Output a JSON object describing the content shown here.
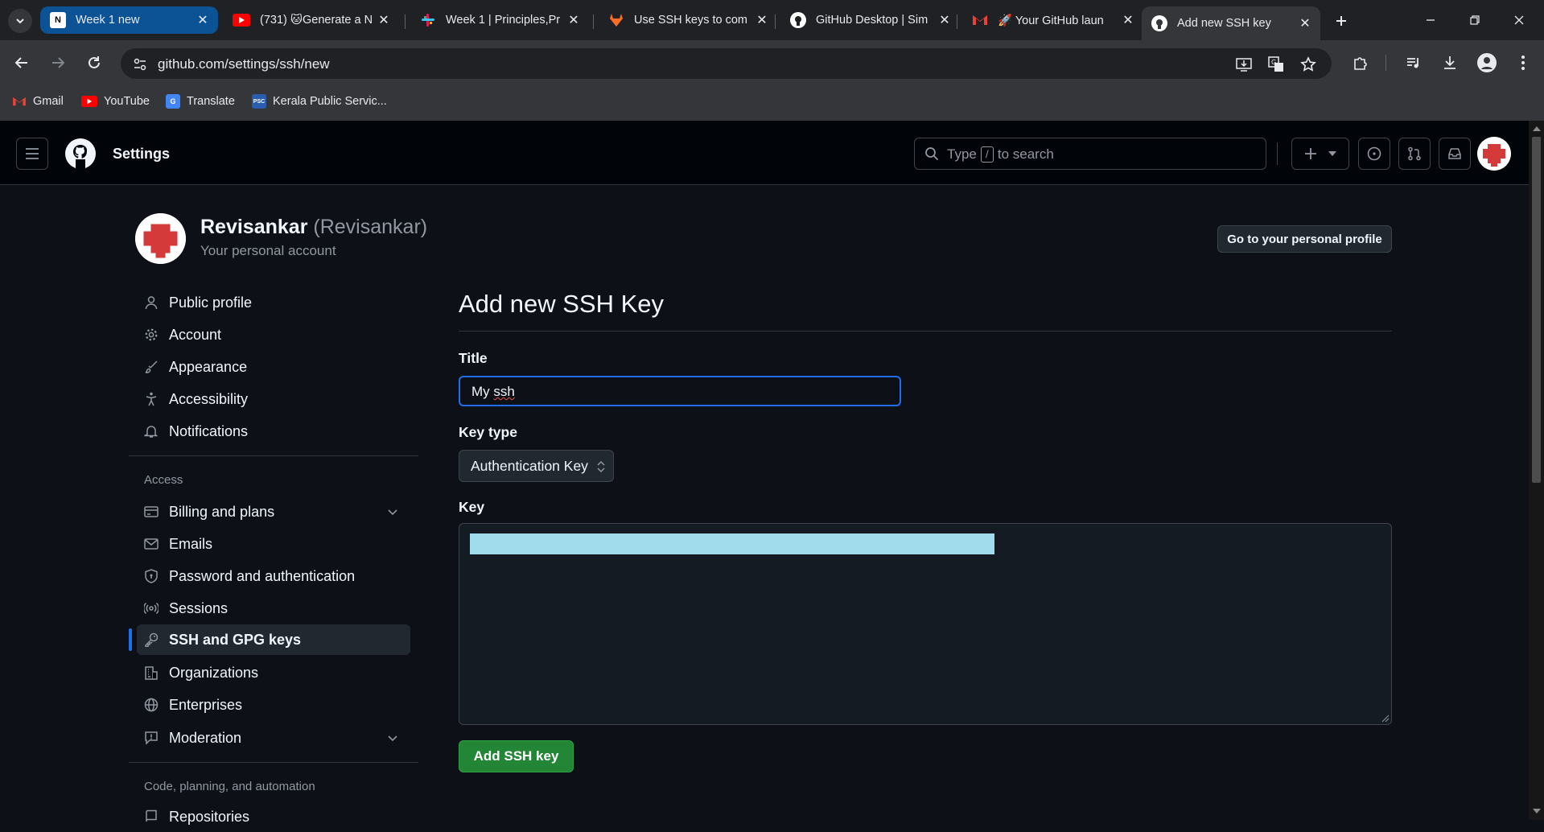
{
  "browser": {
    "tabs": [
      {
        "title": "Week 1 new",
        "icon": "notion-icon"
      },
      {
        "title": "(731) 🐱Generate a N",
        "icon": "youtube-icon"
      },
      {
        "title": "Week 1 | Principles,Pr",
        "icon": "slack-icon"
      },
      {
        "title": "Use SSH keys to com",
        "icon": "gitlab-icon"
      },
      {
        "title": "GitHub Desktop | Sim",
        "icon": "github-icon"
      },
      {
        "title": "🚀 Your GitHub laun",
        "icon": "gmail-icon"
      },
      {
        "title": "Add new SSH key",
        "icon": "github-icon"
      }
    ],
    "url": "github.com/settings/ssh/new",
    "bookmarks": [
      {
        "label": "Gmail",
        "icon": "gmail-icon"
      },
      {
        "label": "YouTube",
        "icon": "youtube-icon"
      },
      {
        "label": "Translate",
        "icon": "translate-icon"
      },
      {
        "label": "Kerala Public Servic...",
        "icon": "psc-icon"
      }
    ]
  },
  "header": {
    "title": "Settings",
    "search": {
      "before": "Type",
      "key": "/",
      "after": "to search"
    }
  },
  "user": {
    "name": "Revisankar",
    "handle": "(Revisankar)",
    "subtitle": "Your personal account",
    "profile_button": "Go to your personal profile"
  },
  "sidebar": {
    "items": [
      {
        "label": "Public profile",
        "icon": "person-icon"
      },
      {
        "label": "Account",
        "icon": "gear-icon"
      },
      {
        "label": "Appearance",
        "icon": "paintbrush-icon"
      },
      {
        "label": "Accessibility",
        "icon": "accessibility-icon"
      },
      {
        "label": "Notifications",
        "icon": "bell-icon"
      }
    ],
    "access_heading": "Access",
    "access_items": [
      {
        "label": "Billing and plans",
        "icon": "credit-card-icon"
      },
      {
        "label": "Emails",
        "icon": "mail-icon"
      },
      {
        "label": "Password and authentication",
        "icon": "shield-icon"
      },
      {
        "label": "Sessions",
        "icon": "broadcast-icon"
      },
      {
        "label": "SSH and GPG keys",
        "icon": "key-icon",
        "selected": true
      },
      {
        "label": "Organizations",
        "icon": "organization-icon"
      },
      {
        "label": "Enterprises",
        "icon": "globe-icon"
      },
      {
        "label": "Moderation",
        "icon": "report-icon"
      }
    ],
    "code_heading": "Code, planning, and automation",
    "code_items": [
      {
        "label": "Repositories",
        "icon": "repo-icon"
      }
    ]
  },
  "form": {
    "heading": "Add new SSH Key",
    "title_label": "Title",
    "title_value": "My ssh",
    "title_value_plain": "My ",
    "title_value_squiggle": "ssh",
    "key_type_label": "Key type",
    "key_type_value": "Authentication Key",
    "key_label": "Key",
    "key_value": "",
    "submit_label": "Add SSH key"
  },
  "colors": {
    "accent": "#1f6feb",
    "submit": "#238636",
    "key_highlight": "#a0dcec"
  }
}
